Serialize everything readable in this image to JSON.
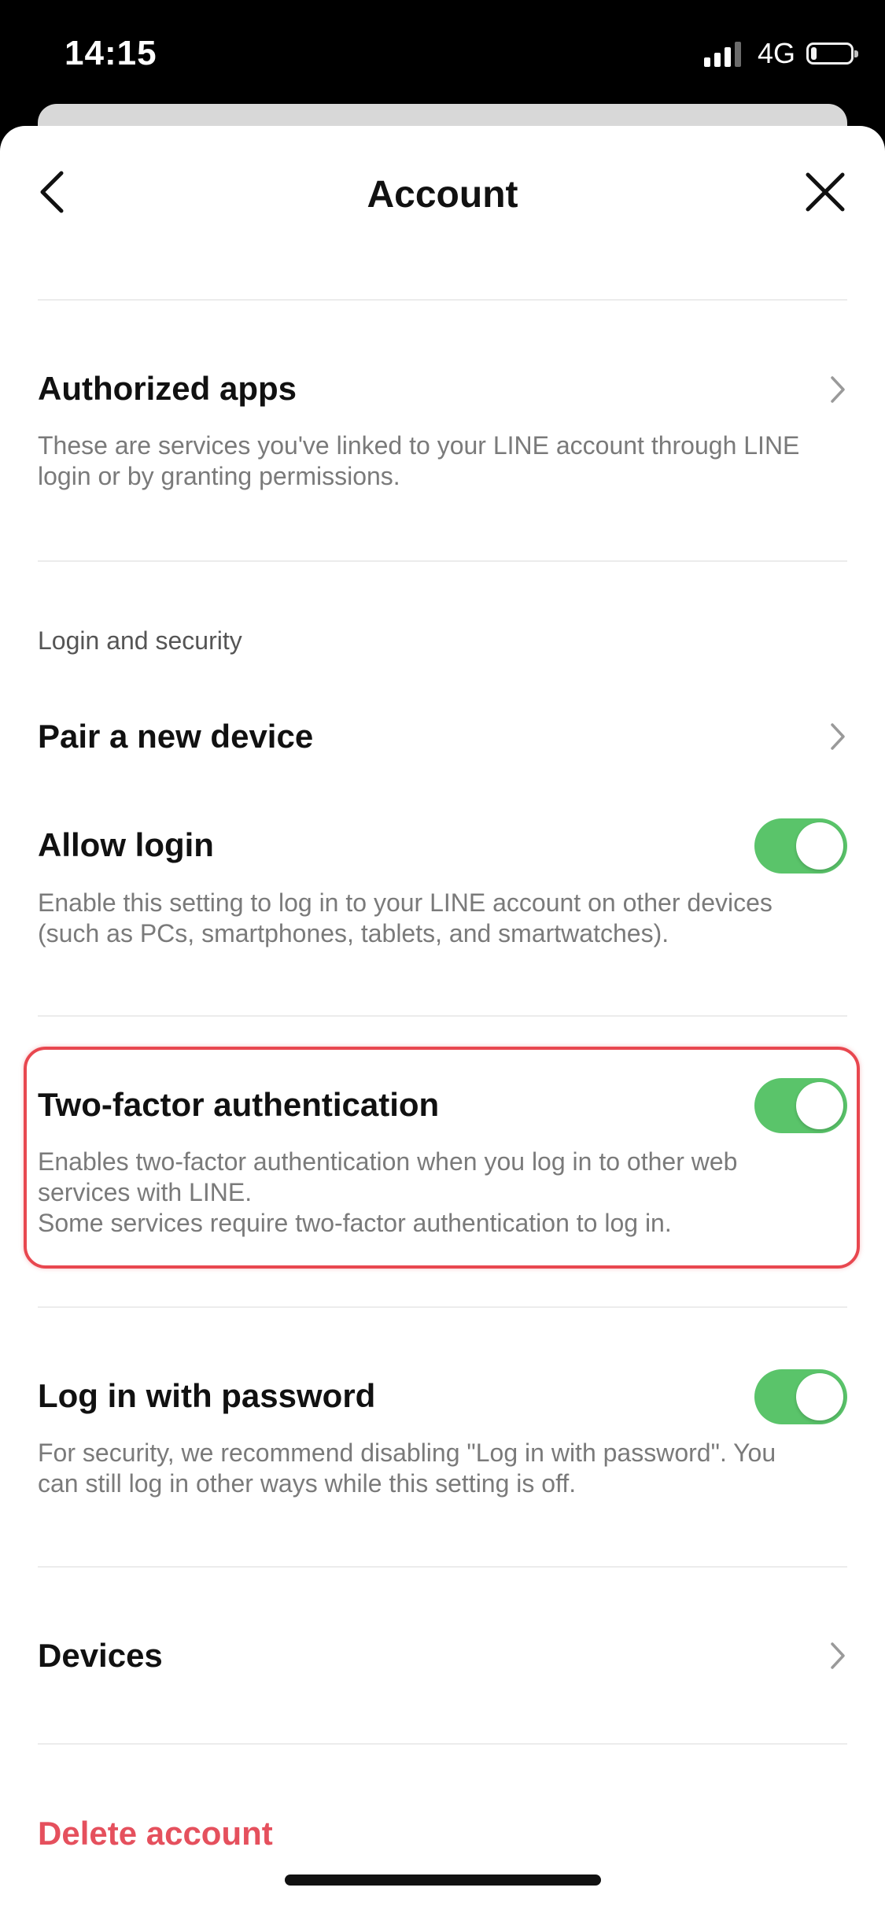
{
  "status_bar": {
    "time": "14:15",
    "network": "4G",
    "battery_level": 0.15
  },
  "nav": {
    "title": "Account",
    "back_icon": "chevron-left-icon",
    "close_icon": "close-icon"
  },
  "authorized_apps": {
    "title": "Authorized apps",
    "description_lines": [
      "These are services you've linked to your LINE account through LINE",
      "login or by granting permissions."
    ]
  },
  "login_security": {
    "section_header": "Login and security",
    "pair_device": {
      "title": "Pair a new device"
    },
    "allow_login": {
      "title": "Allow login",
      "enabled": true,
      "description_lines": [
        "Enable this setting to log in to your LINE account on other devices",
        "(such as PCs, smartphones, tablets, and smartwatches)."
      ]
    },
    "two_factor": {
      "title": "Two-factor authentication",
      "enabled": true,
      "description_lines": [
        "Enables two-factor authentication when you log in to other web",
        "services with LINE.",
        "Some services require two-factor authentication to log in."
      ]
    },
    "password_login": {
      "title": "Log in with password",
      "enabled": true,
      "description_lines": [
        "For security, we recommend disabling \"Log in with password\". You",
        "can still log in other ways while this setting is off."
      ]
    },
    "devices": {
      "title": "Devices"
    }
  },
  "delete_account": {
    "label": "Delete account"
  },
  "colors": {
    "toggle_on": "#5ac46a",
    "danger": "#e5505d",
    "highlight": "#e8474f"
  }
}
